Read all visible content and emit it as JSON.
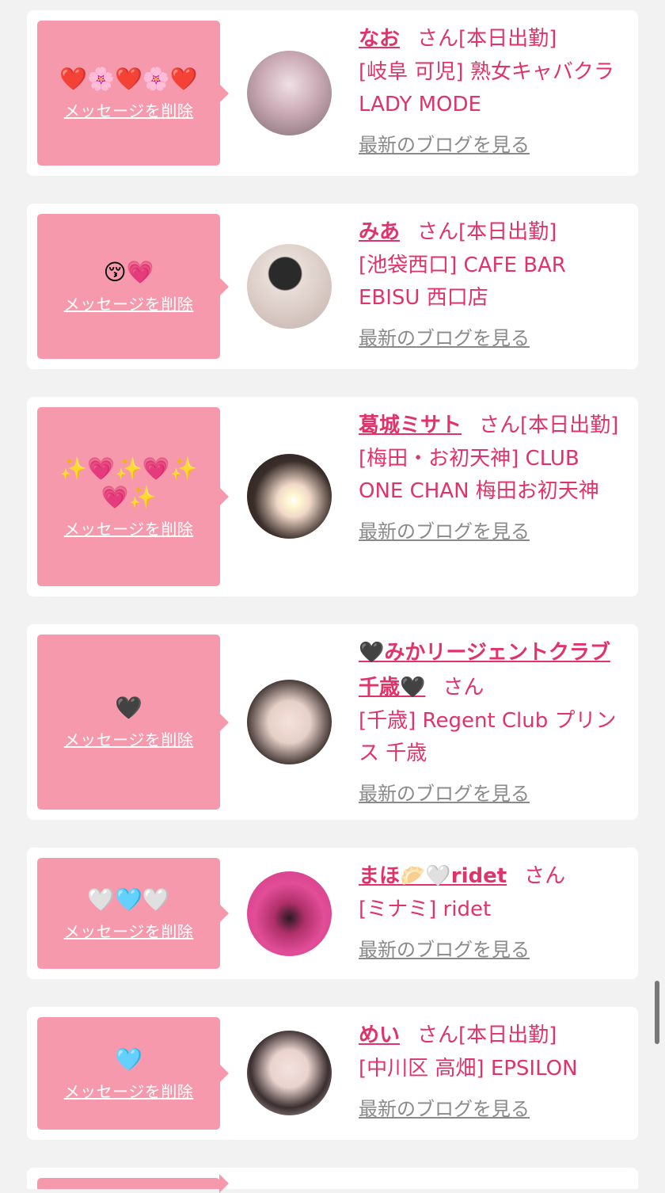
{
  "messages": [
    {
      "emoji": "❤️🌸❤️🌸❤️",
      "delete_label": "メッセージを削除",
      "name": "なお",
      "san": "さん",
      "status": "[本日出勤]",
      "shop": "[岐阜 可児] 熟女キャバクラ LADY MODE",
      "blog_label": "最新のブログを見る"
    },
    {
      "emoji": "😚💗",
      "delete_label": "メッセージを削除",
      "name": "みあ",
      "san": "さん",
      "status": "[本日出勤]",
      "shop": "[池袋西口] CAFE BAR EBISU 西口店",
      "blog_label": "最新のブログを見る"
    },
    {
      "emoji": "✨💗✨💗✨💗✨",
      "delete_label": "メッセージを削除",
      "name": "葛城ミサト",
      "san": "さん",
      "status": "[本日出勤]",
      "shop": "[梅田・お初天神] CLUB ONE CHAN 梅田お初天神",
      "blog_label": "最新のブログを見る"
    },
    {
      "emoji": "🖤",
      "delete_label": "メッセージを削除",
      "name": "🖤みかリージェントクラブ千歳🖤",
      "san": "さん",
      "status": "",
      "shop": "[千歳] Regent Club プリンス 千歳",
      "blog_label": "最新のブログを見る"
    },
    {
      "emoji": "🤍🩵🤍",
      "delete_label": "メッセージを削除",
      "name": "まほ🥟🤍ridet",
      "san": "さん",
      "status": "",
      "shop": "[ミナミ] ridet",
      "blog_label": "最新のブログを見る"
    },
    {
      "emoji": "🩵",
      "delete_label": "メッセージを削除",
      "name": "めい",
      "san": "さん",
      "status": "[本日出勤]",
      "shop": "[中川区 高畑] EPSILON",
      "blog_label": "最新のブログを見る"
    }
  ],
  "colors": {
    "accent": "#e0336a",
    "bubble": "#f799ad",
    "page_bg": "#f2f2f2",
    "link_gray": "#8a8a8a"
  }
}
